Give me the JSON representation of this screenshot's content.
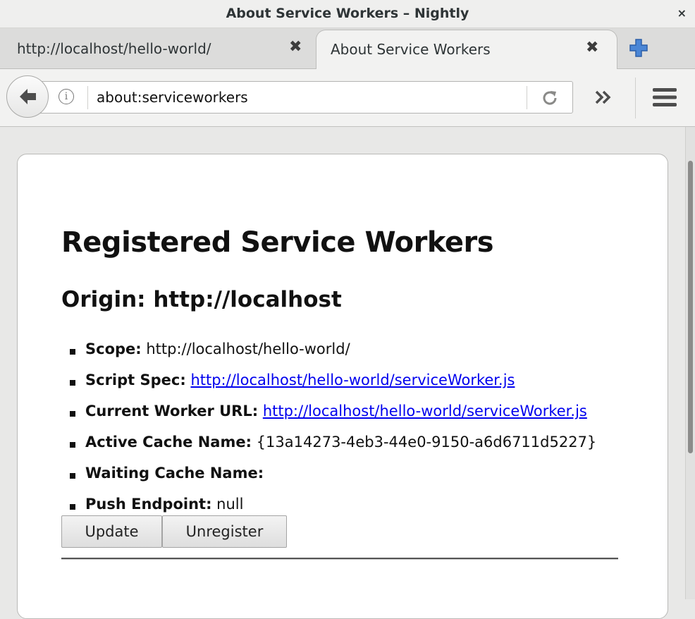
{
  "window": {
    "title": "About Service Workers – Nightly",
    "close_glyph": "×"
  },
  "tabs": [
    {
      "label": "http://localhost/hello-world/",
      "close_glyph": "✖"
    },
    {
      "label": "About Service Workers",
      "close_glyph": "✖"
    }
  ],
  "navbar": {
    "url": "about:serviceworkers",
    "info_glyph": "i",
    "icons": [
      "back-arrow-icon",
      "info-icon",
      "reload-icon",
      "overflow-chevron-icon",
      "hamburger-menu-icon",
      "new-tab-plus-icon"
    ]
  },
  "page": {
    "heading": "Registered Service Workers",
    "origin_heading": "Origin: http://localhost",
    "fields": [
      {
        "key": "Scope:",
        "value": "http://localhost/hello-world/",
        "type": "text"
      },
      {
        "key": "Script Spec:",
        "value": "http://localhost/hello-world/serviceWorker.js",
        "type": "link"
      },
      {
        "key": "Current Worker URL:",
        "value": "http://localhost/hello-world/serviceWorker.js",
        "type": "link"
      },
      {
        "key": "Active Cache Name:",
        "value": "{13a14273-4eb3-44e0-9150-a6d6711d5227}",
        "type": "text"
      },
      {
        "key": "Waiting Cache Name:",
        "value": "",
        "type": "text"
      },
      {
        "key": "Push Endpoint:",
        "value": "null",
        "type": "text"
      }
    ],
    "buttons": {
      "update": "Update",
      "unregister": "Unregister"
    }
  },
  "colors": {
    "link": "#0000ee",
    "new_tab_accent": "#3a7bd5"
  }
}
